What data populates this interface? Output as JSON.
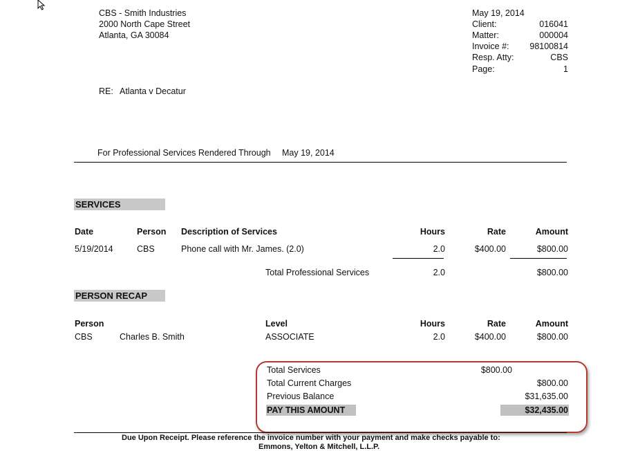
{
  "address": {
    "line1": "CBS - Smith  Industries",
    "line2": "2000 North Cape Street",
    "line3": "Atlanta, GA 30084"
  },
  "invoice_info": {
    "date": "May 19, 2014",
    "client_label": "Client:",
    "client_value": "016041",
    "matter_label": "Matter:",
    "matter_value": "000004",
    "invoice_label": "Invoice #:",
    "invoice_value": "98100814",
    "atty_label": "Resp. Atty:",
    "atty_value": "CBS",
    "page_label": "Page:",
    "page_value": "1"
  },
  "re": {
    "label": "RE:",
    "value": "Atlanta v Decatur"
  },
  "services_through": {
    "text": "For Professional Services Rendered Through",
    "date": "May 19, 2014"
  },
  "services": {
    "heading": "SERVICES",
    "headers": {
      "date": "Date",
      "person": "Person",
      "description": "Description of Services",
      "hours": "Hours",
      "rate": "Rate",
      "amount": "Amount"
    },
    "rows": [
      {
        "date": "5/19/2014",
        "person": "CBS",
        "description": "Phone call with Mr. James. (2.0)",
        "hours": "2.0",
        "rate": "$400.00",
        "amount": "$800.00"
      }
    ],
    "total_label": "Total Professional Services",
    "total_hours": "2.0",
    "total_amount": "$800.00"
  },
  "recap": {
    "heading": "PERSON RECAP",
    "headers": {
      "person": "Person",
      "level": "Level",
      "hours": "Hours",
      "rate": "Rate",
      "amount": "Amount"
    },
    "rows": [
      {
        "initials": "CBS",
        "name": "Charles B. Smith",
        "level": "ASSOCIATE",
        "hours": "2.0",
        "rate": "$400.00",
        "amount": "$800.00"
      }
    ]
  },
  "summary": {
    "total_services_label": "Total Services",
    "total_services_value": "$800.00",
    "current_charges_label": "Total Current Charges",
    "current_charges_value": "$800.00",
    "previous_balance_label": "Previous Balance",
    "previous_balance_value": "$31,635.00",
    "pay_label": "PAY THIS AMOUNT",
    "pay_value": "$32,435.00"
  },
  "footer": {
    "line1": "Due Upon Receipt.  Please reference the invoice number with your payment and make checks payable to:",
    "line2": "Emmons, Yelton & Mitchell, L.L.P."
  },
  "icons": {
    "cursor": "mouse-pointer-icon"
  },
  "colors": {
    "highlight_box": "#b4392f",
    "section_bg": "#c8c8c8"
  }
}
